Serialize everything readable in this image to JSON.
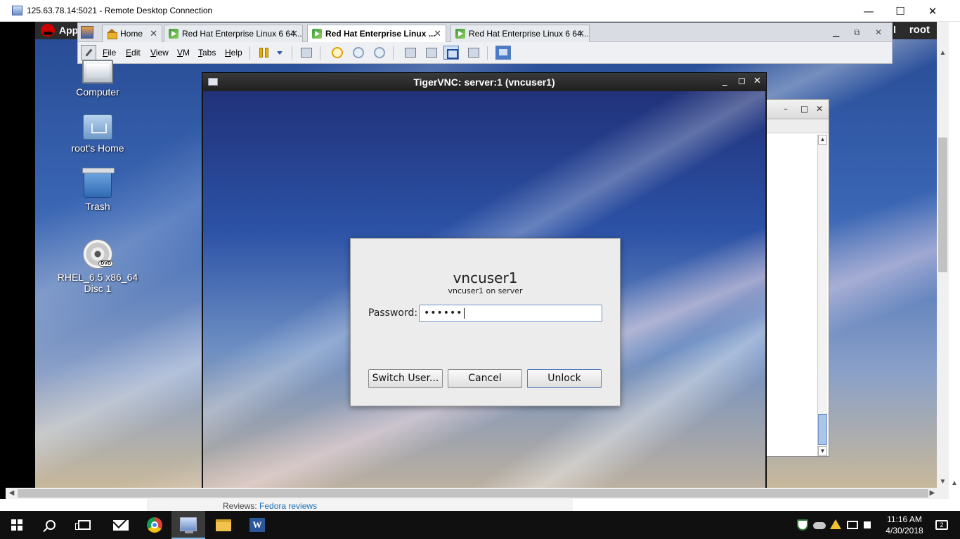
{
  "rdp": {
    "title": "125.63.78.14:5021 - Remote Desktop Connection",
    "minimize": "—",
    "maximize": "☐",
    "close": "✕"
  },
  "gnome_panel": {
    "apps_label": "App",
    "user": "root",
    "partial_text": "l"
  },
  "vmware": {
    "tabs": [
      {
        "label": "Home",
        "icon": "home-icon",
        "active": false
      },
      {
        "label": "Red Hat Enterprise Linux 6 64...",
        "icon": "vm-icon",
        "active": false
      },
      {
        "label": "Red Hat Enterprise Linux ...",
        "icon": "vm-icon",
        "active": true
      },
      {
        "label": "Red Hat Enterprise Linux 6 64...",
        "icon": "vm-icon",
        "active": false
      }
    ],
    "tab_close": "✕",
    "menus": [
      {
        "label": "File",
        "u": "F",
        "rest": "ile"
      },
      {
        "label": "Edit",
        "u": "E",
        "rest": "dit"
      },
      {
        "label": "View",
        "u": "V",
        "rest": "iew"
      },
      {
        "label": "VM",
        "u": "V",
        "rest": "M"
      },
      {
        "label": "Tabs",
        "u": "T",
        "rest": "abs"
      },
      {
        "label": "Help",
        "u": "H",
        "rest": "elp"
      }
    ]
  },
  "desktop_icons": [
    {
      "label": "Computer",
      "icon": "computer-icon"
    },
    {
      "label": "root's Home",
      "icon": "home-folder-icon"
    },
    {
      "label": "Trash",
      "icon": "trash-icon"
    },
    {
      "label": "RHEL_6.5 x86_64 Disc 1",
      "icon": "dvd-icon"
    }
  ],
  "vnc": {
    "title": "TigerVNC: server:1 (vncuser1)",
    "minimize": "_",
    "maximize": "◻",
    "close": "✕"
  },
  "lock_dialog": {
    "user_name": "vncuser1",
    "user_sub": "vncuser1 on server",
    "password_label": "Password:",
    "password_value": "••••••",
    "buttons": {
      "switch_user": "Switch User...",
      "cancel": "Cancel",
      "unlock": "Unlock"
    }
  },
  "background_window": {
    "minimize": "–",
    "maximize": "□",
    "close": "✕"
  },
  "under_strip": {
    "reviews_label": "Reviews:",
    "reviews_link": "Fedora reviews"
  },
  "taskbar": {
    "time": "11:16 AM",
    "date": "4/30/2018",
    "notification_count": "2"
  }
}
